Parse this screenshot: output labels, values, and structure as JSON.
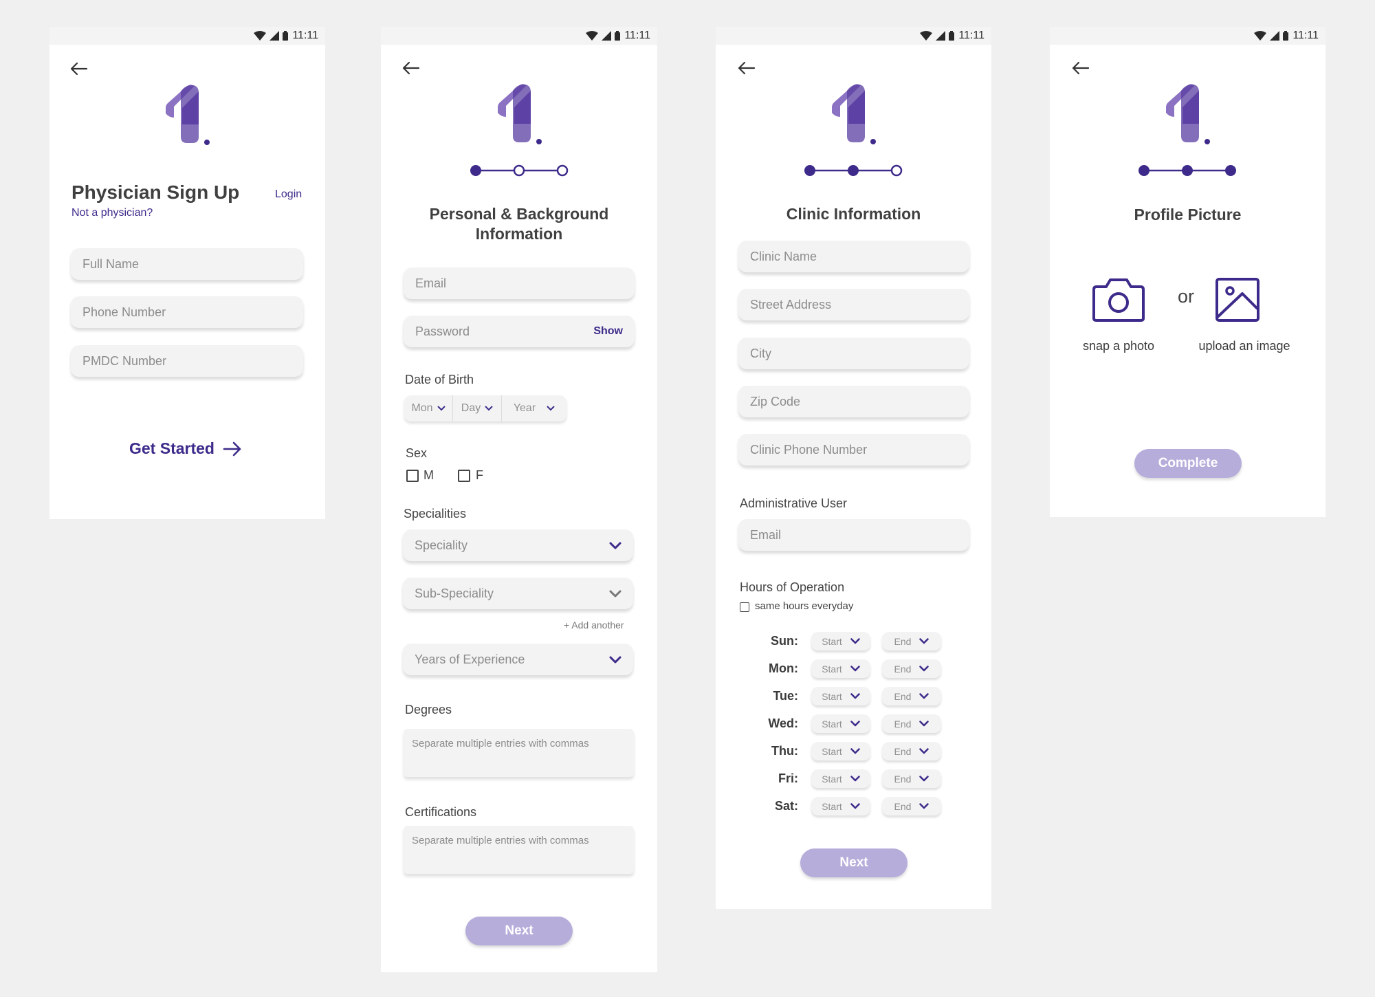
{
  "status_bar": {
    "time": "11:11"
  },
  "colors": {
    "accent": "#3d2a8a",
    "logo_light": "#8c72c2",
    "logo_dark": "#5a3ea2",
    "button_disabled": "#b7addb"
  },
  "screen1": {
    "title": "Physician Sign Up",
    "login_link": "Login",
    "not_physician_link": "Not a physician?",
    "fields": {
      "full_name": "Full Name",
      "phone": "Phone Number",
      "pmdc": "PMDC Number"
    },
    "cta": "Get Started"
  },
  "screen2": {
    "title_line1": "Personal & Background",
    "title_line2": "Information",
    "step": 1,
    "email_placeholder": "Email",
    "password_placeholder": "Password",
    "show_label": "Show",
    "dob_label": "Date of Birth",
    "dob": {
      "month": "Mon",
      "day": "Day",
      "year": "Year"
    },
    "sex_label": "Sex",
    "sex_options": {
      "male": "M",
      "female": "F"
    },
    "specialities_label": "Specialities",
    "speciality_placeholder": "Speciality",
    "sub_speciality_placeholder": "Sub-Speciality",
    "add_another": "+ Add another",
    "experience_placeholder": "Years of Experience",
    "degrees_label": "Degrees",
    "degrees_placeholder": "Separate multiple entries with commas",
    "certifications_label": "Certifications",
    "certifications_placeholder": "Separate multiple entries with commas",
    "next": "Next"
  },
  "screen3": {
    "title": "Clinic Information",
    "step": 2,
    "fields": {
      "clinic_name": "Clinic Name",
      "street": "Street Address",
      "city": "City",
      "zip": "Zip Code",
      "phone": "Clinic Phone Number"
    },
    "admin_label": "Administrative User",
    "admin_email": "Email",
    "hours_label": "Hours of Operation",
    "same_hours": "same hours everyday",
    "days": [
      "Sun:",
      "Mon:",
      "Tue:",
      "Wed:",
      "Thu:",
      "Fri:",
      "Sat:"
    ],
    "start": "Start",
    "end": "End",
    "next": "Next"
  },
  "screen4": {
    "title": "Profile Picture",
    "step": 3,
    "or": "or",
    "snap_label": "snap a photo",
    "upload_label": "upload an image",
    "complete": "Complete"
  }
}
